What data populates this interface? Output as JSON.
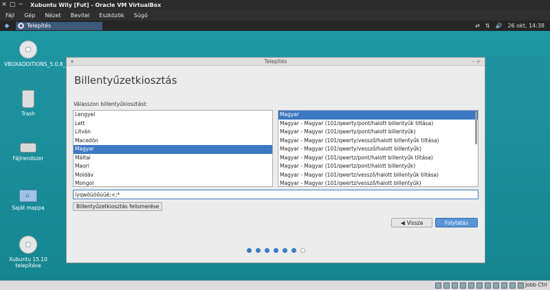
{
  "host": {
    "title": "Xubuntu Wily [Fut] - Oracle VM VirtualBox",
    "menu": [
      "Fájl",
      "Gép",
      "Nézet",
      "Bevitel",
      "Eszközök",
      "Súgó"
    ],
    "hostkey": "Jobb Ctrl"
  },
  "panel": {
    "task_label": "Telepítés",
    "clock": "26 okt, 14:38"
  },
  "desktop": {
    "icons": [
      {
        "label": "VBOXADDITIONS_5.0.8_103..."
      },
      {
        "label": "Trash"
      },
      {
        "label": "Fájlrendszer"
      },
      {
        "label": "Saját mappa"
      },
      {
        "label": "Xubuntu 15.10 telepítése"
      }
    ]
  },
  "window": {
    "title": "Telepítés",
    "heading": "Billentyűzetkiosztás",
    "prompt": "Válasszon billentyűkiosztást:",
    "layouts": [
      "Lengyel",
      "Lett",
      "Litván",
      "Macedón",
      "Magyar",
      "Máltai",
      "Maori",
      "Moldáv",
      "Mongol"
    ],
    "selected_layout_index": 4,
    "variants": [
      "Magyar",
      "Magyar - Magyar (101/qwerty/pont/halott billentyűk tiltása)",
      "Magyar - Magyar (101/qwerty/pont/halott billentyűk)",
      "Magyar - Magyar (101/qwerty/vessző/halott billentyűk tiltása)",
      "Magyar - Magyar (101/qwerty/vessző/halott billentyűk)",
      "Magyar - Magyar (101/qwertz/pont/halott billentyűk tiltása)",
      "Magyar - Magyar (101/qwertz/pont/halott billentyűk)",
      "Magyar - Magyar (101/qwertz/vessző/halott billentyűk tiltása)",
      "Magyar - Magyar (101/qwertz/vessző/halott billentyűk)"
    ],
    "selected_variant_index": 0,
    "test_input_value": "íyqwöüóőúűé;<;*",
    "detect_button": "Billentyűzetkiosztás felismerése",
    "back_button": "Vissza",
    "next_button": "Folytatás",
    "progress": {
      "total": 7,
      "completed": 6
    }
  },
  "colors": {
    "selection": "#3c78c3",
    "primary_button": "#5b94d6",
    "desktop": "#1a8a96"
  }
}
